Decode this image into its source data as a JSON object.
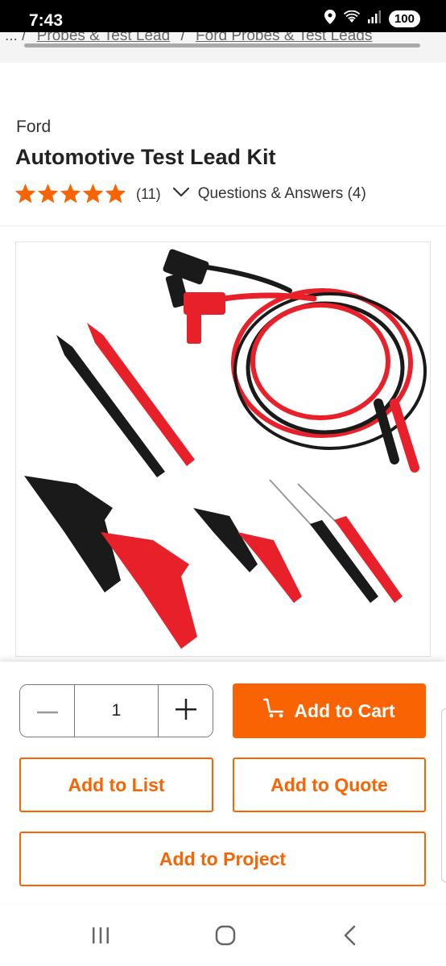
{
  "status_bar": {
    "time": "7:43",
    "battery": "100"
  },
  "breadcrumb": {
    "ellipsis": "...",
    "separator": "/",
    "items": [
      "Probes & Test Lead",
      "Ford Probes & Test Leads"
    ]
  },
  "product": {
    "brand": "Ford",
    "title": "Automotive Test Lead Kit",
    "rating": 5,
    "max_rating": 5,
    "review_count": "(11)",
    "qa_label": "Questions & Answers (4)"
  },
  "purchase": {
    "quantity": "1",
    "add_to_cart": "Add to Cart",
    "add_to_list": "Add to List",
    "add_to_quote": "Add to Quote",
    "add_to_project": "Add to Project"
  },
  "colors": {
    "accent": "#f96302",
    "star": "#f96302",
    "lead_red": "#e8202a",
    "lead_black": "#1a1a1a"
  },
  "icons": [
    "location-icon",
    "wifi-icon",
    "signal-icon",
    "star-icon",
    "chevron-down-icon",
    "minus-icon",
    "plus-icon",
    "cart-icon",
    "recents-icon",
    "home-icon",
    "back-icon"
  ]
}
